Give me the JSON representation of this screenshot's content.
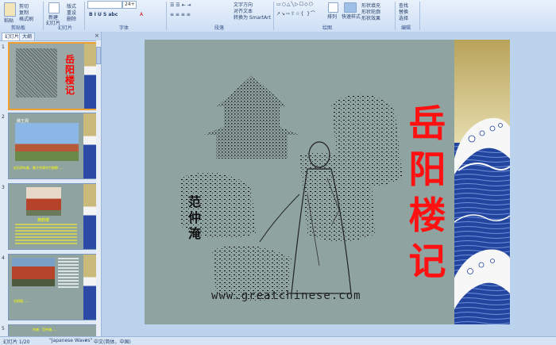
{
  "ribbon": {
    "clipboard": {
      "paste_label": "粘贴",
      "cut_label": "剪切",
      "copy_label": "复制",
      "format_label": "格式刷",
      "group_label": "剪贴板"
    },
    "slides": {
      "new_label": "新建",
      "new_sub": "幻灯片",
      "layout_label": "版式",
      "reset_label": "重设",
      "delete_label": "删除",
      "group_label": "幻灯片"
    },
    "font": {
      "size_value": "24+",
      "group_label": "字体"
    },
    "paragraph": {
      "direction_label": "文字方向",
      "align_label": "对齐文本",
      "smartart_label": "转换为 SmartArt",
      "group_label": "段落"
    },
    "drawing": {
      "arrange_label": "排列",
      "quickstyle_label": "快速样式",
      "fill_label": "形状填充",
      "outline_label": "形状轮廓",
      "effect_label": "形状效果",
      "group_label": "绘图"
    },
    "editing": {
      "find_label": "查找",
      "replace_label": "替换",
      "select_label": "选择",
      "group_label": "编辑"
    }
  },
  "panel": {
    "tabs": [
      "幻灯片",
      "大纲"
    ],
    "thumbnails": [
      {
        "num": "1",
        "title": "岳阳楼记"
      },
      {
        "num": "2",
        "title": "滕王阁",
        "caption": "庆历四年春，滕子京谪守巴陵郡……"
      },
      {
        "num": "3",
        "title": "黄鹤楼",
        "caption": "楼上……"
      },
      {
        "num": "4",
        "caption": "岳阳楼……"
      },
      {
        "num": "5",
        "caption": "作者：范仲淹……"
      }
    ]
  },
  "slide": {
    "title": "岳阳楼记",
    "signature": "范仲淹",
    "watermark": "www.greatchinese.com"
  },
  "status": {
    "slide_info": "幻灯片 1/20",
    "theme": "\"Japanese Waves\"",
    "language": "中文(简体，中国)"
  },
  "colors": {
    "title_red": "#ff1111",
    "ribbon_bg": "#dbe7f6",
    "slide_bg": "#8fa3a0",
    "wave_blue": "#1f3f9b"
  }
}
